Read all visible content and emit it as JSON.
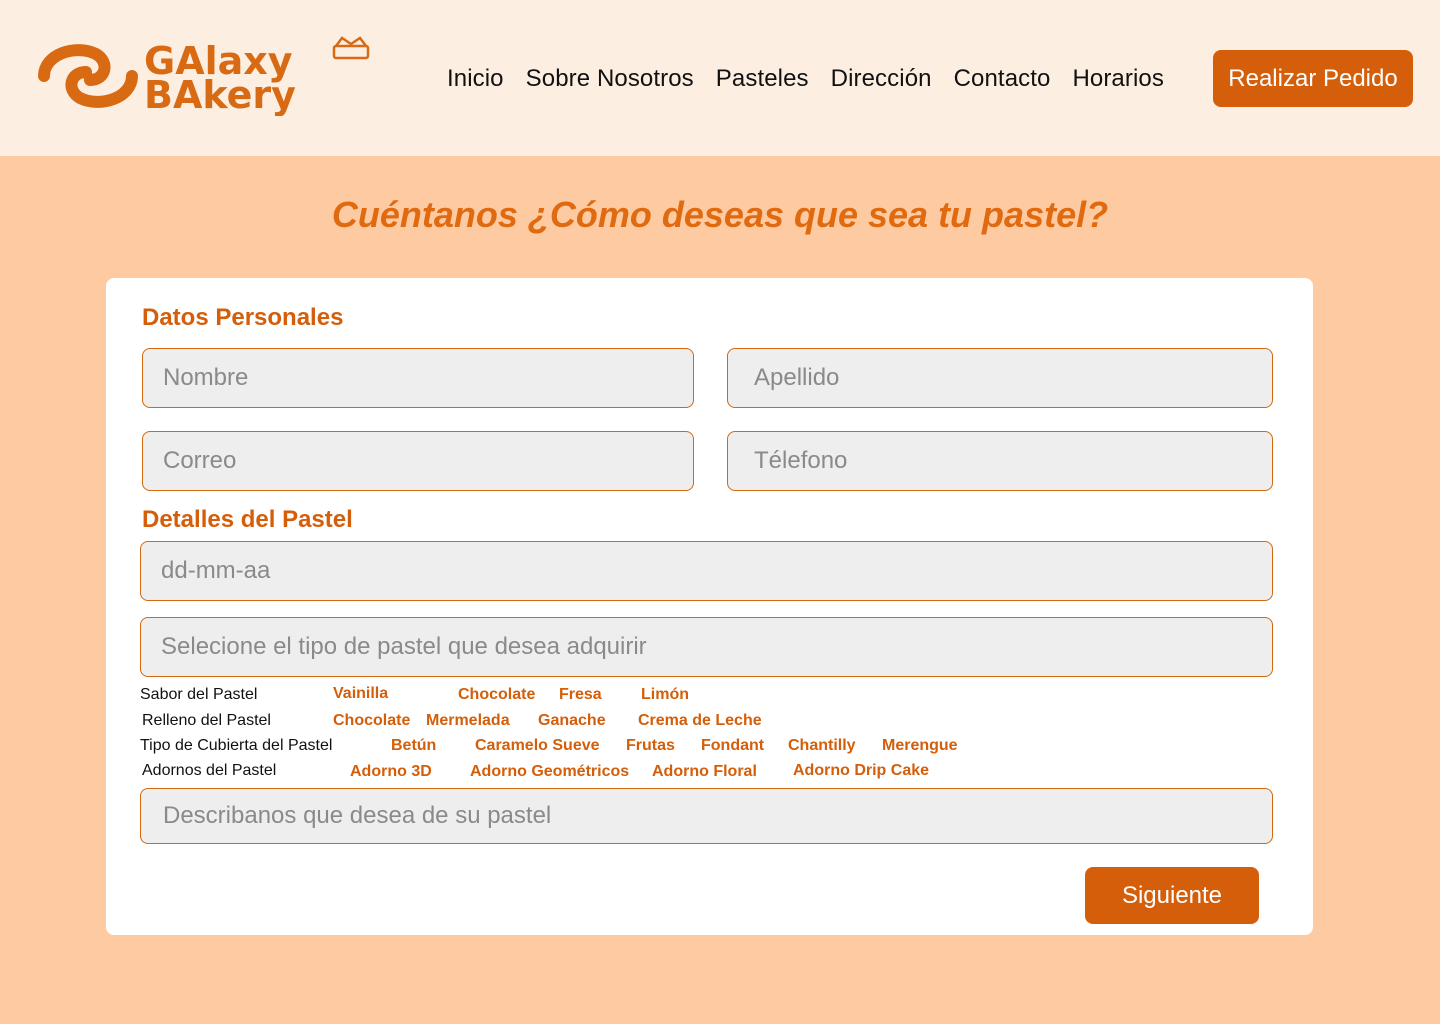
{
  "brand": {
    "logo_line1": "GAlaxy",
    "logo_line2": "BAkery",
    "accent_color": "#d45e0a",
    "header_bg": "#fdeee2",
    "page_bg": "#fecaa2"
  },
  "nav": {
    "items": [
      "Inicio",
      "Sobre Nosotros",
      "Pasteles",
      "Dirección",
      "Contacto",
      "Horarios"
    ],
    "cta": "Realizar Pedido"
  },
  "page": {
    "title": "Cuéntanos ¿Cómo deseas que sea tu pastel?"
  },
  "personal": {
    "title": "Datos Personales",
    "first_name": "Nombre",
    "last_name": "Apellido",
    "email": "Correo",
    "phone": "Télefono"
  },
  "details": {
    "title": "Detalles del Pastel",
    "date": "dd-mm-aa",
    "cake_type": "Selecione el tipo de pastel que desea adquirir",
    "flavor_label": "Sabor del Pastel",
    "flavors": [
      "Vainilla",
      "Chocolate",
      "Fresa",
      "Limón"
    ],
    "filling_label": "Relleno del Pastel",
    "fillings": [
      "Chocolate",
      "Mermelada",
      "Ganache",
      "Crema de Leche"
    ],
    "cover_label": "Tipo de Cubierta del Pastel",
    "covers": [
      "Betún",
      "Caramelo Sueve",
      "Frutas",
      "Fondant",
      "Chantilly",
      "Merengue"
    ],
    "decor_label": "Adornos del Pastel",
    "decors": [
      "Adorno 3D",
      "Adorno Geométricos",
      "Adorno Floral",
      "Adorno Drip Cake"
    ],
    "description": "Describanos que desea de su pastel"
  },
  "actions": {
    "next": "Siguiente"
  }
}
